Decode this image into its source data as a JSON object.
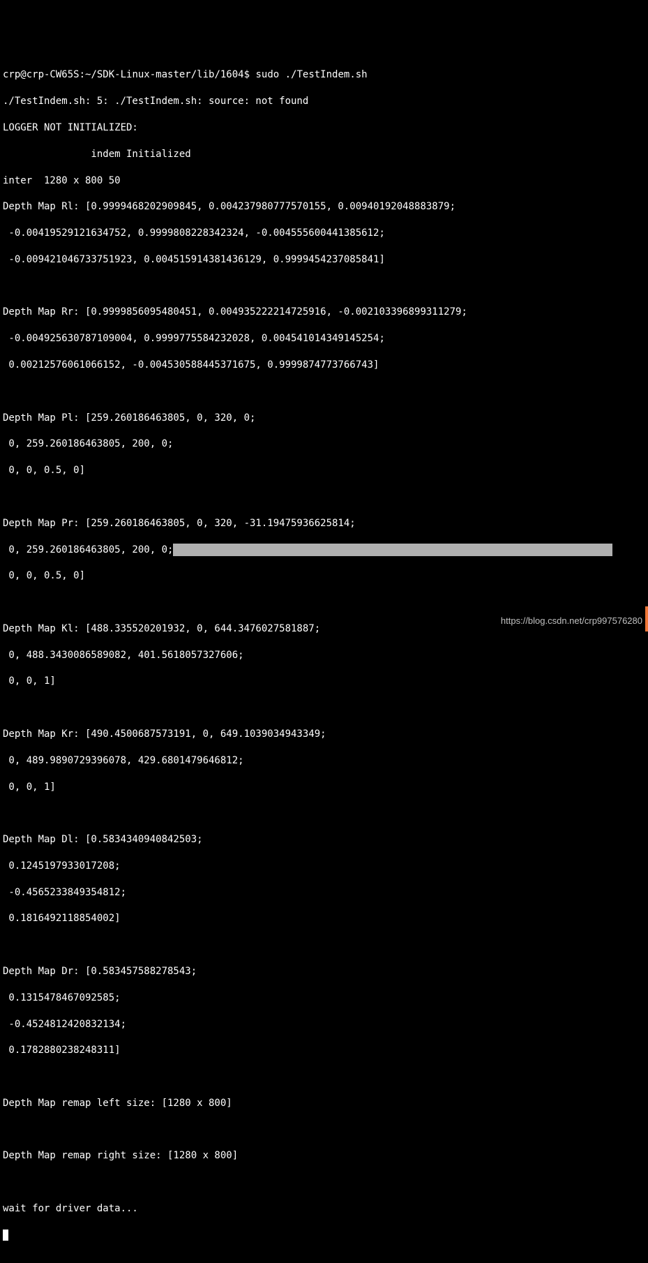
{
  "prompt": {
    "user_host": "crp@crp-CW65S",
    "cwd": "~/SDK-Linux-master/lib/1604",
    "separator": "$",
    "command": "sudo ./TestIndem.sh"
  },
  "output": {
    "line_err": "./TestIndem.sh: 5: ./TestIndem.sh: source: not found",
    "logger": "LOGGER NOT INITIALIZED:",
    "indem_init": "               indem Initialized",
    "inter": "inter  1280 x 800 50",
    "rl_title": "Depth Map Rl: [0.9999468202909845, 0.004237980777570155, 0.00940192048883879;",
    "rl_l2": " -0.00419529121634752, 0.9999808228342324, -0.004555600441385612;",
    "rl_l3": " -0.009421046733751923, 0.004515914381436129, 0.9999454237085841]",
    "rr_title": "Depth Map Rr: [0.9999856095480451, 0.004935222214725916, -0.002103396899311279;",
    "rr_l2": " -0.004925630787109004, 0.9999775584232028, 0.004541014349145254;",
    "rr_l3": " 0.00212576061066152, -0.004530588445371675, 0.9999874773766743]",
    "pl_title": "Depth Map Pl: [259.260186463805, 0, 320, 0;",
    "pl_l2": " 0, 259.260186463805, 200, 0;",
    "pl_l3": " 0, 0, 0.5, 0]",
    "pr_title": "Depth Map Pr: [259.260186463805, 0, 320, -31.19475936625814;",
    "pr_l2_pre": " 0, 259.260186463805, 200, 0;",
    "pr_l3": " 0, 0, 0.5, 0]",
    "kl_title": "Depth Map Kl: [488.335520201932, 0, 644.3476027581887;",
    "kl_l2": " 0, 488.3430086589082, 401.5618057327606;",
    "kl_l3": " 0, 0, 1]",
    "kr_title": "Depth Map Kr: [490.4500687573191, 0, 649.1039034943349;",
    "kr_l2": " 0, 489.9890729396078, 429.6801479646812;",
    "kr_l3": " 0, 0, 1]",
    "dl_title": "Depth Map Dl: [0.5834340940842503;",
    "dl_l2": " 0.1245197933017208;",
    "dl_l3": " -0.4565233849354812;",
    "dl_l4": " 0.1816492118854002]",
    "dr_title": "Depth Map Dr: [0.583457588278543;",
    "dr_l2": " 0.1315478467092585;",
    "dr_l3": " -0.4524812420832134;",
    "dr_l4": " 0.1782880238248311]",
    "remap_left": "Depth Map remap left size: [1280 x 800]",
    "remap_right": "Depth Map remap right size: [1280 x 800]",
    "wait": "wait for driver data..."
  },
  "watermark": "https://blog.csdn.net/crp997576280"
}
